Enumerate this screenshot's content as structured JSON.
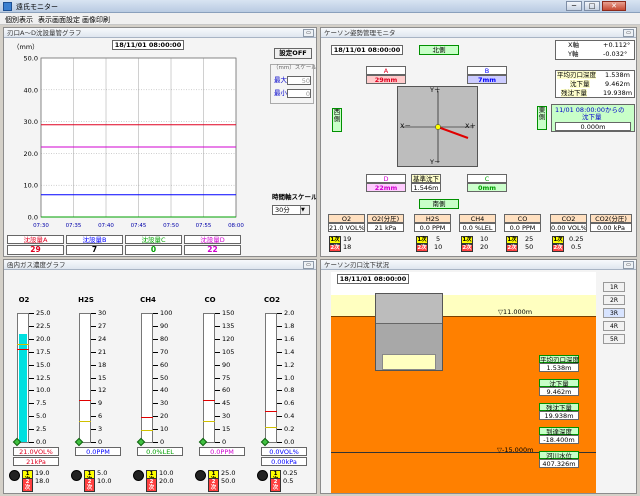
{
  "window": {
    "title": "遠氏モニター",
    "minimize": "─",
    "maximize": "□",
    "close": "✕"
  },
  "menu": [
    "個別表示",
    "表示画面設定",
    "画像印刷"
  ],
  "graph_panel": {
    "title": "刃口A〜D沈設量管グラフ",
    "datetime": "18/11/01 08:00:00",
    "unit": "（mm）",
    "settings_button": "設定OFF",
    "scale_label": "（mm）スケール",
    "max_label": "最大",
    "max_value": "50",
    "min_label": "最小",
    "min_value": "0",
    "time_scale_label": "時間軸スケール",
    "time_scale_value": "30分",
    "series": [
      {
        "name": "沈設量A",
        "value": "29",
        "color": "#e00020"
      },
      {
        "name": "沈設量B",
        "value": "7",
        "color": "#0000ff"
      },
      {
        "name": "沈設量C",
        "value": "0",
        "color": "#00a000"
      },
      {
        "name": "沈設量D",
        "value": "22",
        "color": "#d000d0"
      }
    ]
  },
  "chart_data": {
    "type": "line",
    "x": [
      "07:30",
      "07:35",
      "07:40",
      "07:45",
      "07:50",
      "07:55",
      "08:00"
    ],
    "yticks": [
      "0.0",
      "10.0",
      "20.0",
      "30.0",
      "40.0",
      "50.0"
    ],
    "ylim": [
      0,
      50
    ],
    "grid": true,
    "series": [
      {
        "name": "沈設量A",
        "values": [
          29,
          29,
          29,
          29,
          29,
          29,
          29
        ],
        "color": "#e00020"
      },
      {
        "name": "沈設量B",
        "values": [
          7,
          7,
          7,
          7,
          7,
          7,
          7
        ],
        "color": "#0000ff"
      },
      {
        "name": "沈設量C",
        "values": [
          0,
          0,
          0,
          0,
          0,
          0,
          0
        ],
        "color": "#00a000"
      },
      {
        "name": "沈設量D",
        "values": [
          22,
          22,
          22,
          22,
          22,
          22,
          22
        ],
        "color": "#d000d0"
      }
    ]
  },
  "posture_panel": {
    "title": "ケーソン姿勢管理モニタ",
    "datetime": "18/11/01 08:00:00",
    "north": "北側",
    "south": "南側",
    "west": "西側",
    "east": "東側",
    "axis_yplus": "Y＋",
    "axis_yminus": "Y－",
    "axis_xminus": "X－",
    "axis_xplus": "X＋",
    "A": {
      "label": "A",
      "value": "29mm"
    },
    "B": {
      "label": "B",
      "value": "7mm"
    },
    "C": {
      "label": "C",
      "value": "0mm"
    },
    "D": {
      "label": "D",
      "value": "22mm"
    },
    "base_label": "基準沈下",
    "base_value": "1.546m",
    "x_label": "X軸",
    "x_value": "+0.112°",
    "y_label": "Y軸",
    "y_value": "-0.032°",
    "metrics": [
      {
        "label": "平均刃口深度",
        "value": "1.538m"
      },
      {
        "label": "沈下量",
        "value": "9.462m"
      },
      {
        "label": "残沈下量",
        "value": "19.938m"
      }
    ],
    "since_label": "11/01 08:00:00からの",
    "since_sub": "沈下量",
    "since_value": "0.000m",
    "gas_headers": [
      "O2",
      "O2(分圧)",
      "H2S",
      "CH4",
      "CO",
      "CO2",
      "CO2(分圧)"
    ],
    "gas_values": [
      "21.0 VOL%",
      "21 kPa",
      "0.0 PPM",
      "0.0 %LEL",
      "0.0 PPM",
      "0.00 VOL%",
      "0.00 kPa"
    ],
    "gas_thresholds": [
      {
        "k1": "1次",
        "v1": "19",
        "k2": "2次",
        "v2": "18"
      },
      {
        "k1": "1次",
        "v1": "5",
        "k2": "2次",
        "v2": "10"
      },
      {
        "k1": "1次",
        "v1": "10",
        "k2": "2次",
        "v2": "20"
      },
      {
        "k1": "1次",
        "v1": "25",
        "k2": "2次",
        "v2": "50"
      },
      {
        "k1": "1次",
        "v1": "0.25",
        "k2": "2次",
        "v2": "0.5"
      }
    ]
  },
  "gas_panel": {
    "title": "函内ガス濃度グラフ",
    "gauges": [
      {
        "name": "O2",
        "ticks": [
          "25.0",
          "22.5",
          "20.0",
          "17.5",
          "15.0",
          "12.5",
          "10.0",
          "7.5",
          "5.0",
          "2.5",
          "0.0"
        ],
        "max": 25,
        "value": 21.0,
        "fill": "#00e0e0",
        "reading": "21.0VOL%",
        "reading_color": "#e00020",
        "sub": "21kPa",
        "k1": "1次",
        "t1": "19.0",
        "k2": "2次",
        "t2": "18.0"
      },
      {
        "name": "H2S",
        "ticks": [
          "30",
          "27",
          "24",
          "21",
          "18",
          "15",
          "12",
          "9",
          "6",
          "3",
          "0"
        ],
        "max": 30,
        "value": 0,
        "fill": "#00e0e0",
        "reading": "0.0PPM",
        "reading_color": "#0000ff",
        "sub": "",
        "k1": "1次",
        "t1": "5.0",
        "k2": "2次",
        "t2": "10.0"
      },
      {
        "name": "CH4",
        "ticks": [
          "100",
          "90",
          "80",
          "70",
          "60",
          "50",
          "40",
          "30",
          "20",
          "10",
          "0"
        ],
        "max": 100,
        "value": 0,
        "fill": "#00e0e0",
        "reading": "0.0%LEL",
        "reading_color": "#00a000",
        "sub": "",
        "k1": "1次",
        "t1": "10.0",
        "k2": "2次",
        "t2": "20.0"
      },
      {
        "name": "CO",
        "ticks": [
          "150",
          "135",
          "120",
          "105",
          "90",
          "75",
          "60",
          "45",
          "30",
          "15",
          "0"
        ],
        "max": 150,
        "value": 0,
        "fill": "#00e0e0",
        "reading": "0.0PPM",
        "reading_color": "#d000d0",
        "sub": "",
        "k1": "1次",
        "t1": "25.0",
        "k2": "2次",
        "t2": "50.0"
      },
      {
        "name": "CO2",
        "ticks": [
          "2.0",
          "1.8",
          "1.6",
          "1.4",
          "1.2",
          "1.0",
          "0.8",
          "0.6",
          "0.4",
          "0.2",
          "0.0"
        ],
        "max": 2,
        "value": 0,
        "fill": "#00e0e0",
        "reading": "0.0VOL%",
        "reading_color": "#0000ff",
        "sub": "0.00kPa",
        "k1": "1次",
        "t1": "0.25",
        "k2": "2次",
        "t2": "0.5"
      }
    ]
  },
  "settlement_panel": {
    "title": "ケーソン刃口沈下状況",
    "datetime": "18/11/01 08:00:00",
    "level_top": "▽11.000m",
    "level_bottom": "▽-15.000m",
    "buttons": [
      "1R",
      "2R",
      "3R",
      "4R",
      "5R"
    ],
    "metrics": [
      {
        "label": "平均刃口深度",
        "value": "1.538m"
      },
      {
        "label": "沈下量",
        "value": "9.462m"
      },
      {
        "label": "残沈下量",
        "value": "19.938m"
      },
      {
        "label": "到達深度",
        "value": "-18.400m"
      },
      {
        "label": "河川水位",
        "value": "407.326m"
      }
    ]
  }
}
